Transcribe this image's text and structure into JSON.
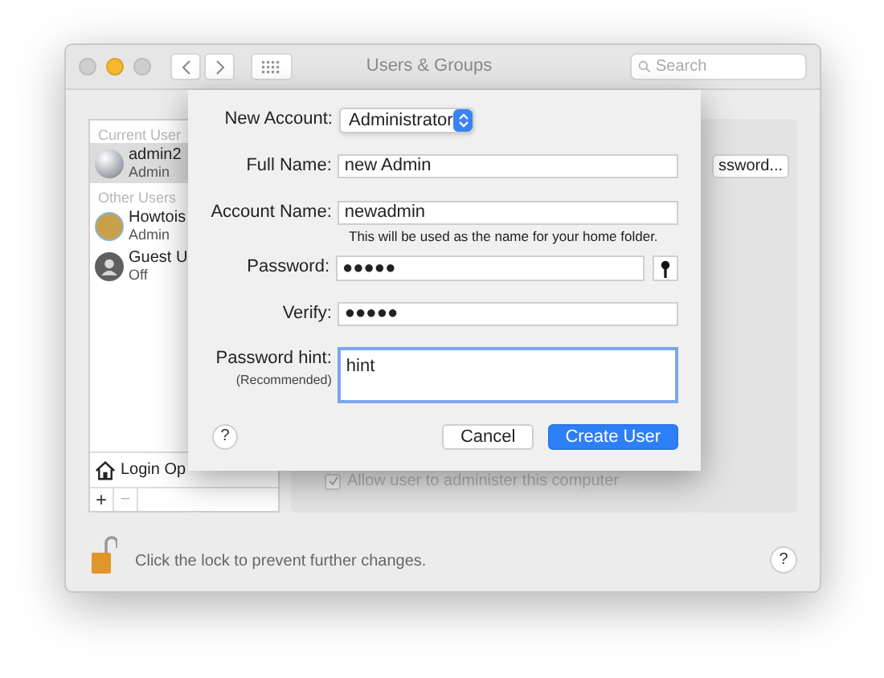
{
  "window": {
    "title": "Users & Groups",
    "search": {
      "placeholder": "Search"
    }
  },
  "sidebar": {
    "sections": [
      {
        "header": "Current User",
        "users": [
          {
            "name": "admin2",
            "role": "Admin",
            "selected": true,
            "kind": "sphere"
          }
        ]
      },
      {
        "header": "Other Users",
        "users": [
          {
            "name": "Howtois",
            "role": "Admin",
            "selected": false,
            "kind": "picture"
          },
          {
            "name": "Guest U",
            "role": "Off",
            "selected": false,
            "kind": "guest"
          }
        ]
      }
    ],
    "login_options": "Login Op",
    "add_button": "+",
    "remove_button": "−"
  },
  "detail": {
    "button": "ssword...",
    "admin_checkbox": {
      "label": "Allow user to administer this computer",
      "checked": true,
      "disabled": true
    }
  },
  "footer": {
    "lock_text": "Click the lock to prevent further changes.",
    "help": "?"
  },
  "sheet": {
    "fields": [
      {
        "kind": "popup",
        "label": "New Account:",
        "value": "Administrator"
      },
      {
        "kind": "text",
        "label": "Full Name:",
        "value": "new Admin"
      },
      {
        "kind": "text",
        "label": "Account Name:",
        "value": "newadmin",
        "note": "This will be used as the name for your home folder."
      },
      {
        "kind": "password",
        "label": "Password:",
        "value": "●●●●●"
      },
      {
        "kind": "text",
        "label": "Verify:",
        "value": "●●●●●"
      },
      {
        "kind": "textarea",
        "label": "Password hint:",
        "sublabel": "(Recommended)",
        "value": "hint",
        "focused": true
      }
    ],
    "help": "?",
    "buttons": [
      {
        "label": "Cancel",
        "default": false
      },
      {
        "label": "Create User",
        "default": true
      }
    ]
  }
}
